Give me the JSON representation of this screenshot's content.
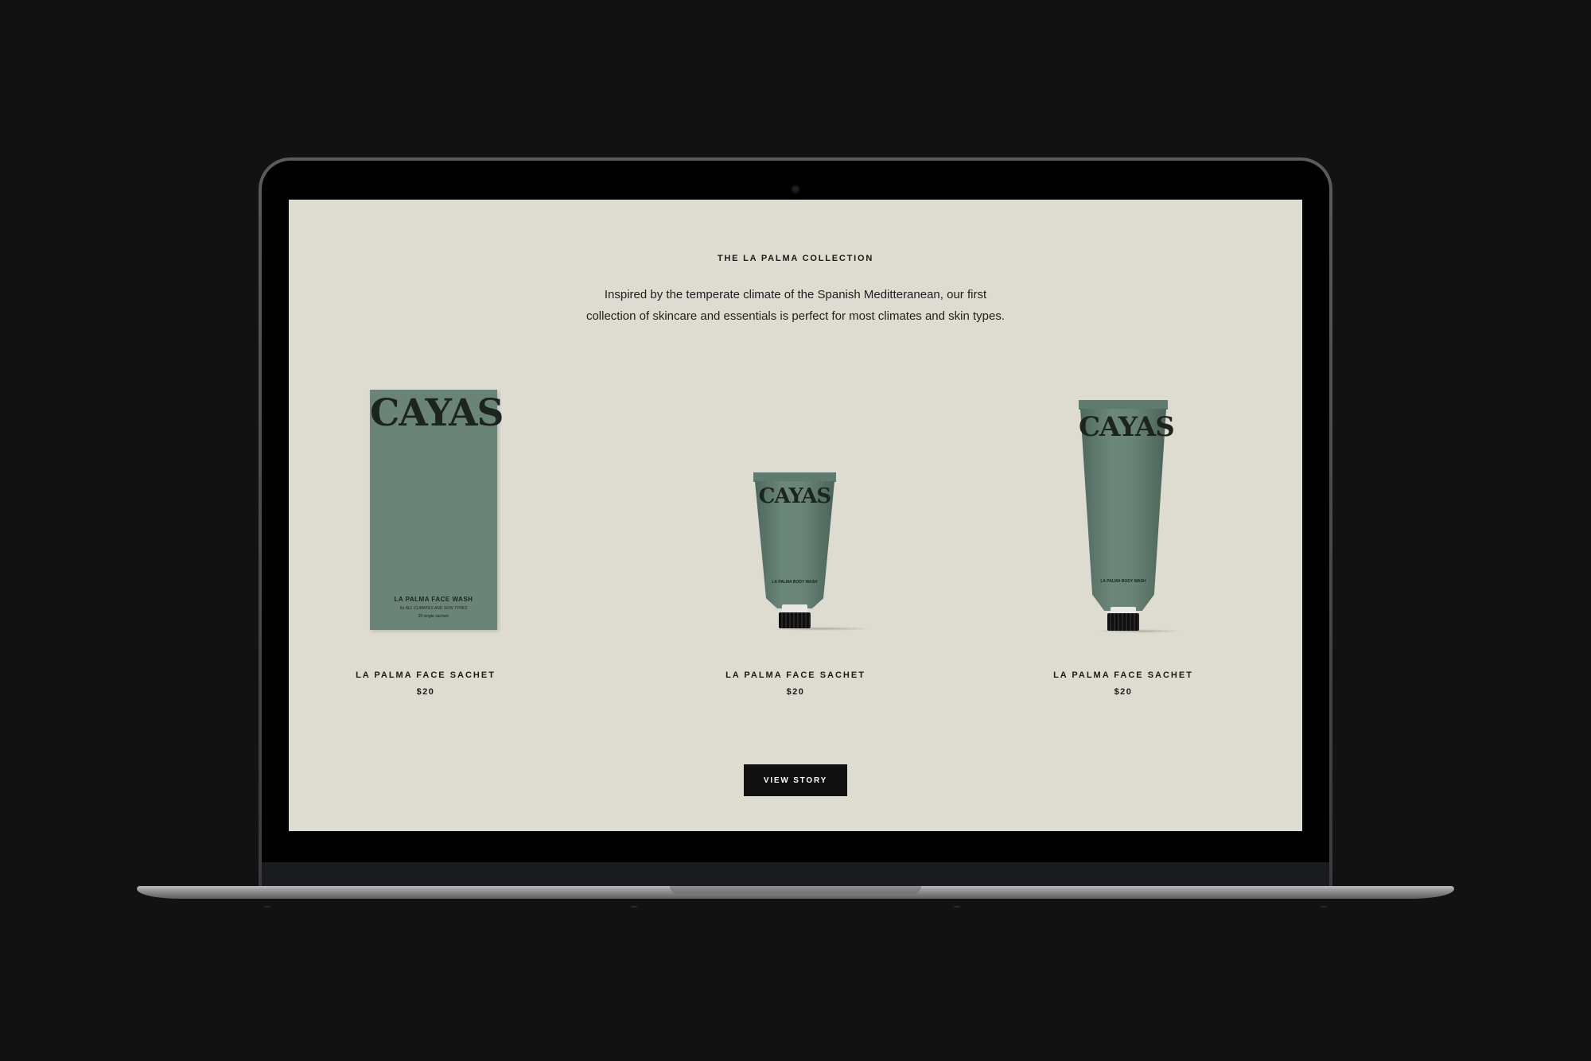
{
  "collection": {
    "eyebrow": "THE LA PALMA COLLECTION",
    "intro_line1": "Inspired by the temperate climate of the Spanish Meditteranean, our first",
    "intro_line2": "collection of skincare and essentials is perfect for most climates and skin types."
  },
  "products": [
    {
      "name": "LA PALMA FACE SACHET",
      "price": "$20",
      "package": {
        "brand": "CAYAS",
        "label": "LA PALMA FACE WASH",
        "sub1": "for ALL CLIMATES AND SKIN TYPES",
        "sub2": "30 single sachets"
      }
    },
    {
      "name": "LA PALMA FACE SACHET",
      "price": "$20",
      "package": {
        "brand": "CAYAS",
        "label": "LA PALMA BODY WASH"
      }
    },
    {
      "name": "LA PALMA FACE SACHET",
      "price": "$20",
      "package": {
        "brand": "CAYAS",
        "label": "LA PALMA BODY WASH"
      }
    }
  ],
  "cta": {
    "label": "VIEW STORY"
  },
  "colors": {
    "page_background": "#121212",
    "screen_background": "#dedbd0",
    "product_green": "#6b8478",
    "button_background": "#101010",
    "button_text": "#ffffff"
  }
}
